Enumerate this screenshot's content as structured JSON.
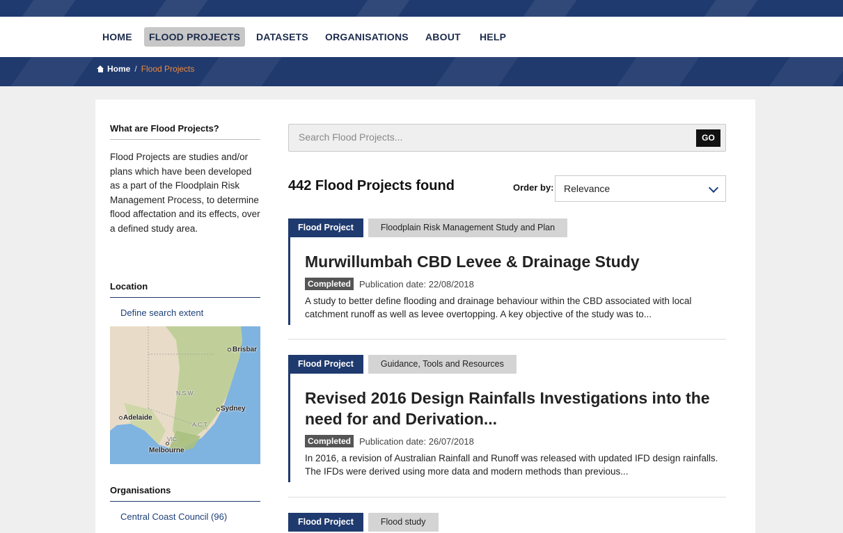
{
  "nav": {
    "items": [
      {
        "label": "HOME",
        "active": false
      },
      {
        "label": "FLOOD PROJECTS",
        "active": true
      },
      {
        "label": "DATASETS",
        "active": false
      },
      {
        "label": "ORGANISATIONS",
        "active": false
      },
      {
        "label": "ABOUT",
        "active": false
      },
      {
        "label": "HELP",
        "active": false
      }
    ]
  },
  "breadcrumb": {
    "home": "Home",
    "separator": "/",
    "current": "Flood Projects"
  },
  "sidebar": {
    "about_heading": "What are Flood Projects?",
    "about_text": "Flood Projects are studies and/or plans which have been developed as a part of the Floodplain Risk Management Process, to determine flood affectation and its effects, over a defined study area.",
    "location_heading": "Location",
    "define_extent_link": "Define search extent",
    "map_labels": {
      "brisbane": "Brisbar",
      "nsw": "N.S.W.",
      "sydney": "Sydney",
      "adelaide": "Adelaide",
      "act": "A.C.T.",
      "vic": "VIC",
      "melbourne": "Melbourne"
    },
    "organisations_heading": "Organisations",
    "organisations": [
      {
        "label": "Central Coast Council (96)"
      }
    ]
  },
  "search": {
    "placeholder": "Search Flood Projects...",
    "go_label": "GO"
  },
  "results": {
    "count_text": "442 Flood Projects found",
    "order_label": "Order by:",
    "order_value": "Relevance",
    "items": [
      {
        "tag_primary": "Flood Project",
        "tag_secondary": "Floodplain Risk Management Study and Plan",
        "title": "Murwillumbah CBD Levee & Drainage Study",
        "status": "Completed",
        "pub_date": "Publication date: 22/08/2018",
        "description": "A study to better define flooding and drainage behaviour within the CBD associated with local catchment runoff as well as levee overtopping. A key objective of the study was to..."
      },
      {
        "tag_primary": "Flood Project",
        "tag_secondary": "Guidance, Tools and Resources",
        "title": "Revised 2016 Design Rainfalls Investigations into the need for and Derivation...",
        "status": "Completed",
        "pub_date": "Publication date: 26/07/2018",
        "description": "In 2016, a revision of Australian Rainfall and Runoff was released with updated IFD design rainfalls. The IFDs were derived using more data and modern methods than previous..."
      },
      {
        "tag_primary": "Flood Project",
        "tag_secondary": "Flood study"
      }
    ]
  },
  "colors": {
    "brand_navy": "#1f3a6e",
    "breadcrumb_current": "#f08a3b",
    "link_blue": "#1c3f7a"
  }
}
